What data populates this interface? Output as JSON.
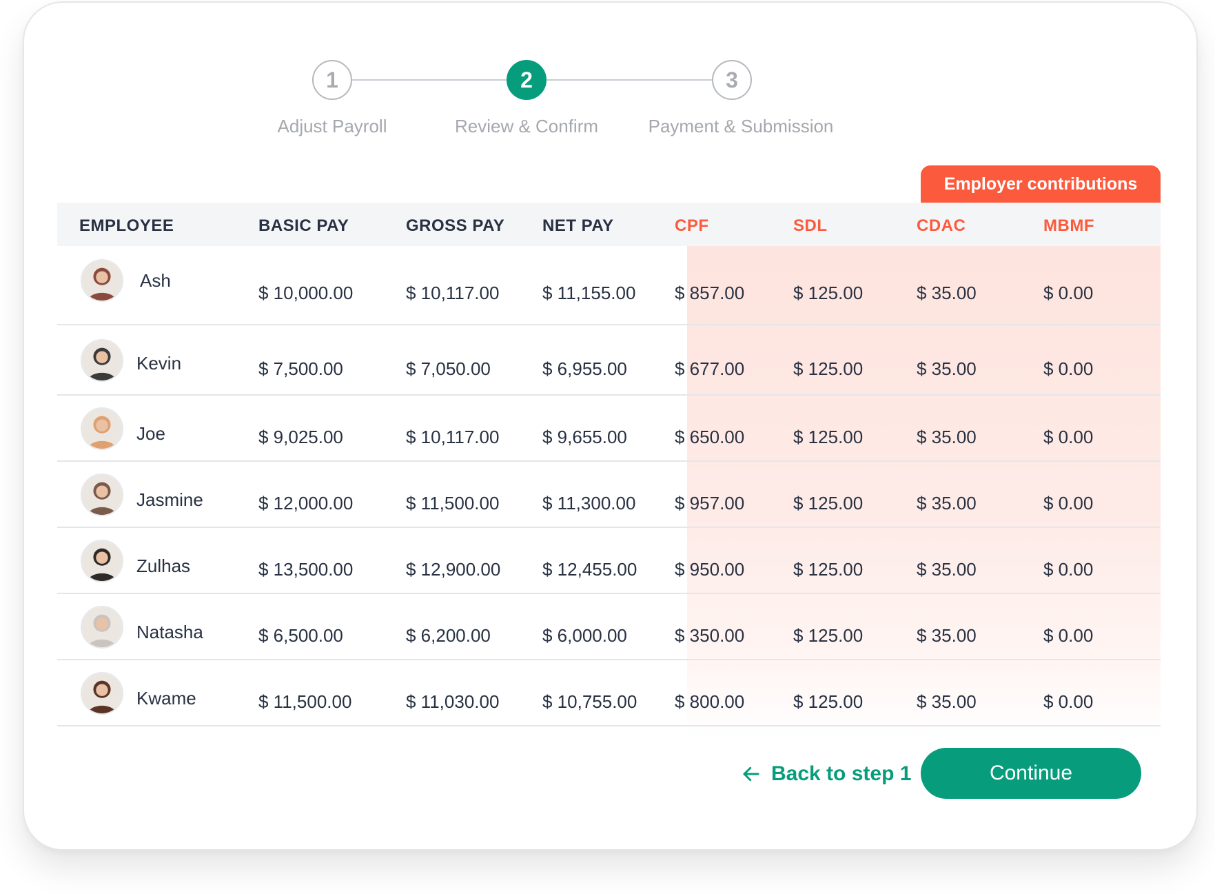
{
  "stepper": {
    "steps": [
      {
        "number": "1",
        "label": "Adjust Payroll",
        "active": false
      },
      {
        "number": "2",
        "label": "Review & Confirm",
        "active": true
      },
      {
        "number": "3",
        "label": "Payment & Submission",
        "active": false
      }
    ]
  },
  "contributions_tab": "Employer contributions",
  "table": {
    "headers": [
      "EMPLOYEE",
      "BASIC PAY",
      "GROSS PAY",
      "NET PAY",
      "CPF",
      "SDL",
      "CDAC",
      "MBMF"
    ],
    "rows": [
      {
        "name": "Ash",
        "basic": "$ 10,000.00",
        "gross": "$ 10,117.00",
        "net": "$ 11,155.00",
        "cpf": "$ 857.00",
        "sdl": "$ 125.00",
        "cdac": "$ 35.00",
        "mbmf": "$ 0.00"
      },
      {
        "name": "Kevin",
        "basic": "$ 7,500.00",
        "gross": "$ 7,050.00",
        "net": "$ 6,955.00",
        "cpf": "$ 677.00",
        "sdl": "$ 125.00",
        "cdac": "$ 35.00",
        "mbmf": "$ 0.00"
      },
      {
        "name": "Joe",
        "basic": "$ 9,025.00",
        "gross": "$ 10,117.00",
        "net": "$ 9,655.00",
        "cpf": "$ 650.00",
        "sdl": "$ 125.00",
        "cdac": "$ 35.00",
        "mbmf": "$ 0.00"
      },
      {
        "name": "Jasmine",
        "basic": "$ 12,000.00",
        "gross": "$ 11,500.00",
        "net": "$ 11,300.00",
        "cpf": "$ 957.00",
        "sdl": "$ 125.00",
        "cdac": "$ 35.00",
        "mbmf": "$ 0.00"
      },
      {
        "name": "Zulhas",
        "basic": "$ 13,500.00",
        "gross": "$ 12,900.00",
        "net": "$ 12,455.00",
        "cpf": "$ 950.00",
        "sdl": "$ 125.00",
        "cdac": "$ 35.00",
        "mbmf": "$ 0.00"
      },
      {
        "name": "Natasha",
        "basic": "$ 6,500.00",
        "gross": "$ 6,200.00",
        "net": "$ 6,000.00",
        "cpf": "$ 350.00",
        "sdl": "$ 125.00",
        "cdac": "$ 35.00",
        "mbmf": "$ 0.00"
      },
      {
        "name": "Kwame",
        "basic": "$ 11,500.00",
        "gross": "$ 11,030.00",
        "net": "$ 10,755.00",
        "cpf": "$ 800.00",
        "sdl": "$ 125.00",
        "cdac": "$ 35.00",
        "mbmf": "$ 0.00"
      }
    ]
  },
  "avatar_colors": [
    "#8a4b3c",
    "#3b3b3b",
    "#e0a070",
    "#7a5a48",
    "#2f2a28",
    "#c9c4c0",
    "#5a3526"
  ],
  "footer": {
    "back_label": "Back to step 1",
    "continue_label": "Continue"
  },
  "colors": {
    "accent": "#079d7c",
    "employer_highlight": "#fc5a3c",
    "employer_bg": "#fee4de",
    "header_text": "#283142"
  }
}
